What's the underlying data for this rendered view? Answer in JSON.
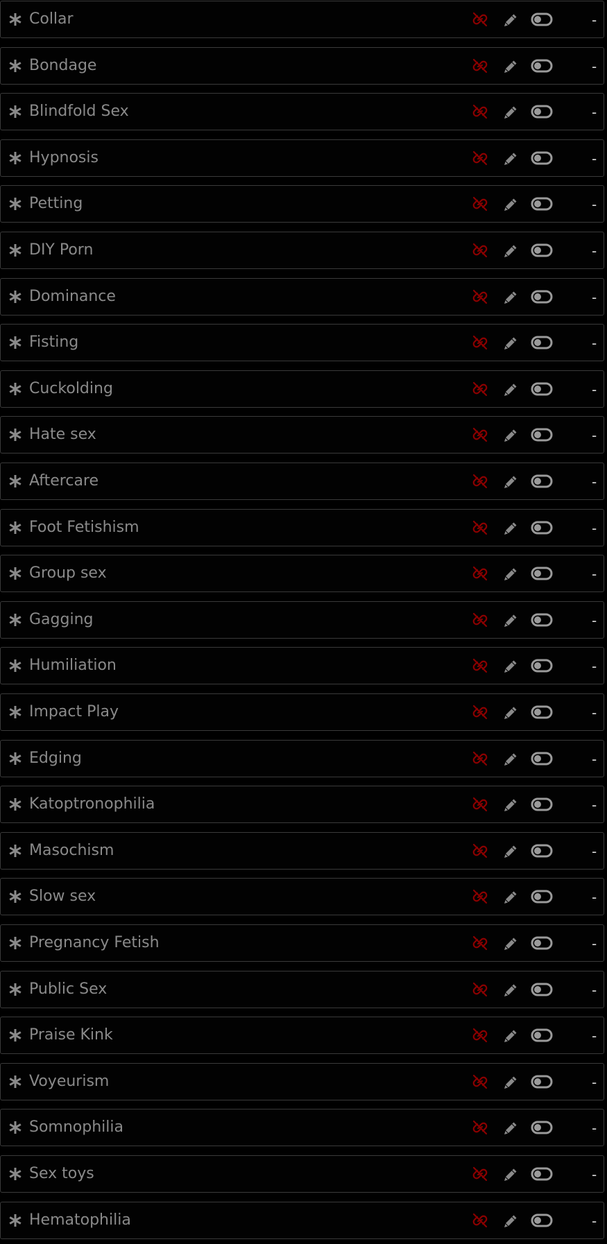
{
  "colors": {
    "background": "#000000",
    "row_border": "#3a3a3a",
    "text": "#8a8a8a",
    "unlink_icon": "#8b0000",
    "edit_icon": "#8a8a8a",
    "toggle_icon": "#9a9a9a",
    "dash": "#d8d8d8"
  },
  "icons": {
    "leading": "asterisk-icon",
    "unlink": "unlink-icon",
    "edit": "pencil-icon",
    "toggle": "toggle-icon"
  },
  "items": [
    {
      "name": "Collar",
      "value": "-"
    },
    {
      "name": "Bondage",
      "value": "-"
    },
    {
      "name": "Blindfold Sex",
      "value": "-"
    },
    {
      "name": "Hypnosis",
      "value": "-"
    },
    {
      "name": "Petting",
      "value": "-"
    },
    {
      "name": "DIY Porn",
      "value": "-"
    },
    {
      "name": "Dominance",
      "value": "-"
    },
    {
      "name": "Fisting",
      "value": "-"
    },
    {
      "name": "Cuckolding",
      "value": "-"
    },
    {
      "name": "Hate sex",
      "value": "-"
    },
    {
      "name": "Aftercare",
      "value": "-"
    },
    {
      "name": "Foot Fetishism",
      "value": "-"
    },
    {
      "name": "Group sex",
      "value": "-"
    },
    {
      "name": "Gagging",
      "value": "-"
    },
    {
      "name": "Humiliation",
      "value": "-"
    },
    {
      "name": "Impact Play",
      "value": "-"
    },
    {
      "name": "Edging",
      "value": "-"
    },
    {
      "name": "Katoptronophilia",
      "value": "-"
    },
    {
      "name": "Masochism",
      "value": "-"
    },
    {
      "name": "Slow sex",
      "value": "-"
    },
    {
      "name": "Pregnancy Fetish",
      "value": "-"
    },
    {
      "name": "Public Sex",
      "value": "-"
    },
    {
      "name": "Praise Kink",
      "value": "-"
    },
    {
      "name": "Voyeurism",
      "value": "-"
    },
    {
      "name": "Somnophilia",
      "value": "-"
    },
    {
      "name": "Sex toys",
      "value": "-"
    },
    {
      "name": "Hematophilia",
      "value": "-"
    }
  ]
}
